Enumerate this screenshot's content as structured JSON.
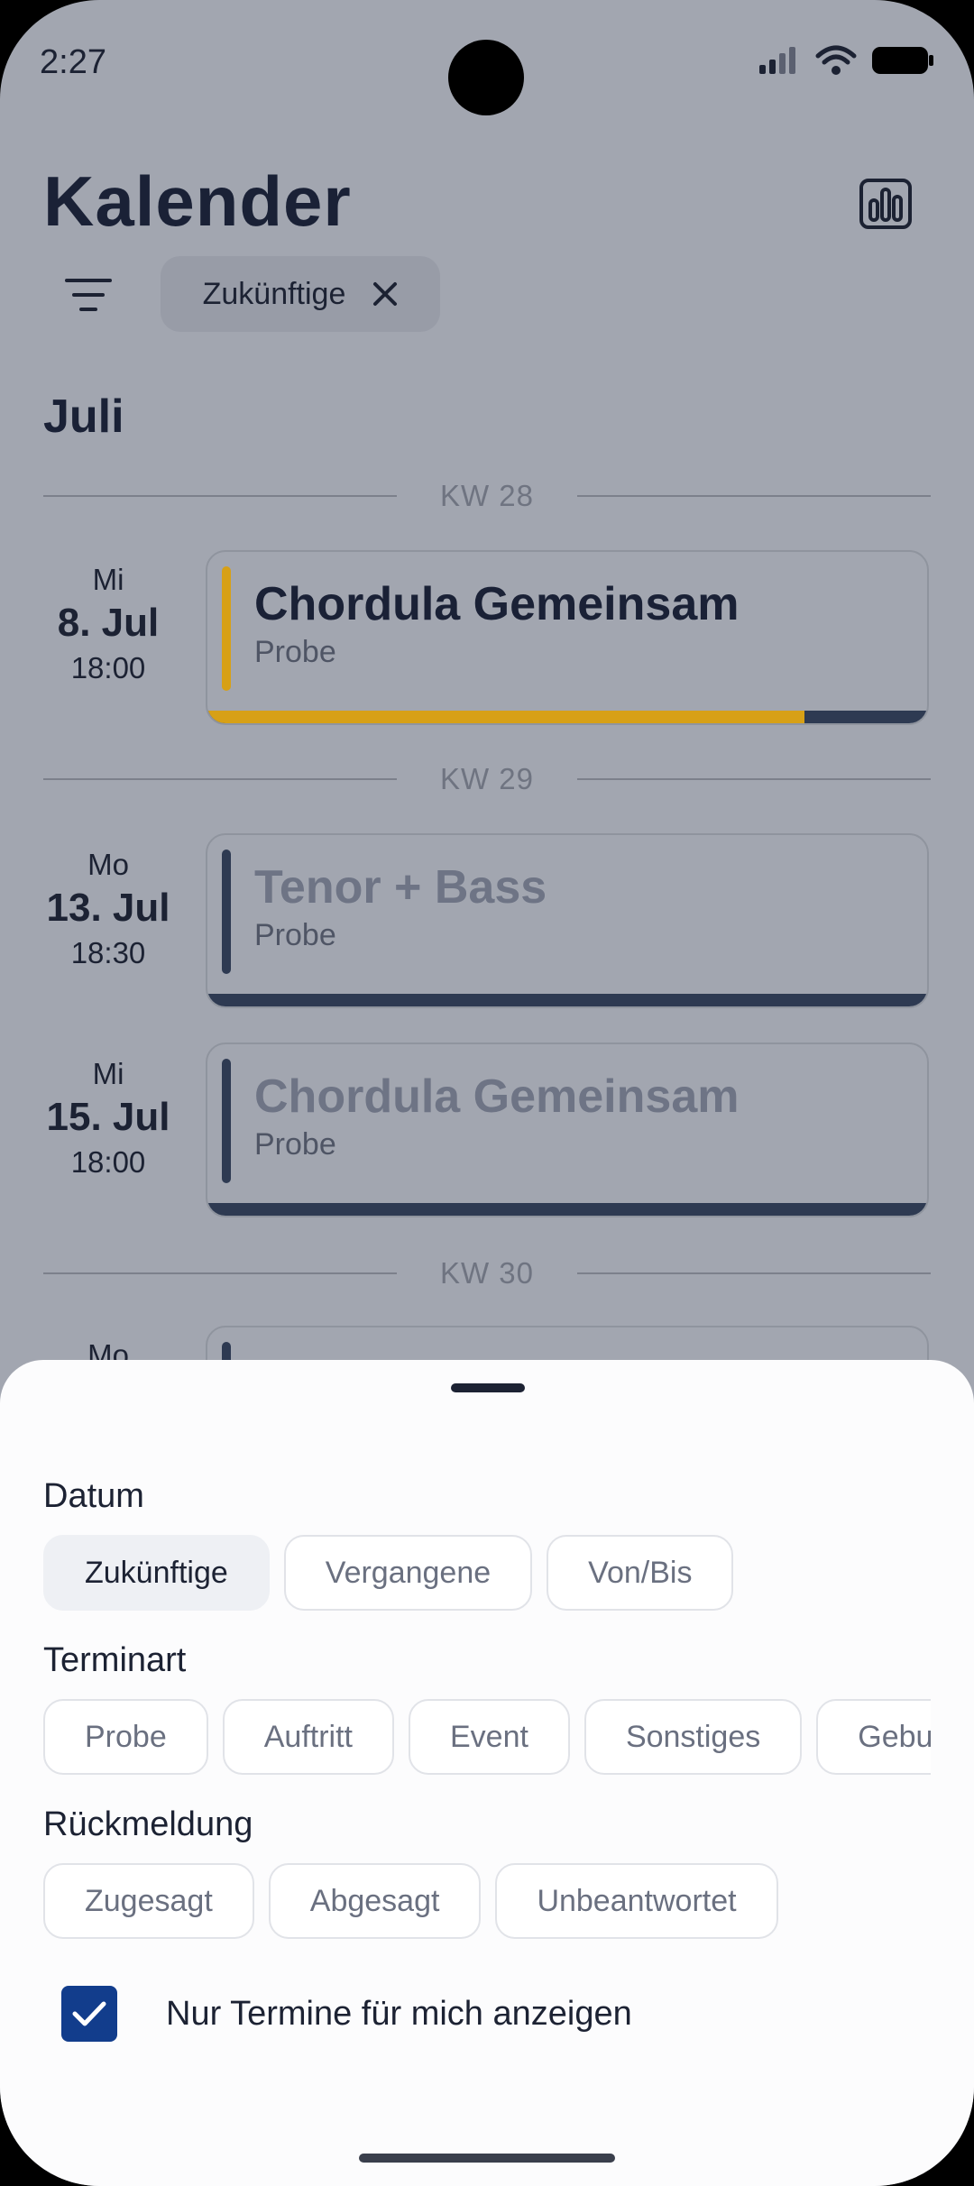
{
  "status": {
    "time": "2:27"
  },
  "header": {
    "title": "Kalender",
    "active_filter": "Zukünftige"
  },
  "month": "Juli",
  "weeks": [
    "KW 28",
    "KW 29",
    "KW 30"
  ],
  "events": [
    {
      "dow": "Mi",
      "day": "8. Jul",
      "time": "18:00",
      "title": "Chordula Gemeinsam",
      "type": "Probe",
      "accent": "#d7a016",
      "progress": 0.83
    },
    {
      "dow": "Mo",
      "day": "13. Jul",
      "time": "18:30",
      "title": "Tenor + Bass",
      "type": "Probe",
      "accent": "#2e3a52",
      "progress": 0
    },
    {
      "dow": "Mi",
      "day": "15. Jul",
      "time": "18:00",
      "title": "Chordula Gemeinsam",
      "type": "Probe",
      "accent": "#2e3a52",
      "progress": 0
    }
  ],
  "next_event_dow": "Mo",
  "sheet": {
    "date_label": "Datum",
    "date_options": [
      "Zukünftige",
      "Vergangene",
      "Von/Bis"
    ],
    "type_label": "Terminart",
    "type_options": [
      "Probe",
      "Auftritt",
      "Event",
      "Sonstiges",
      "Geburtstag"
    ],
    "response_label": "Rückmeldung",
    "response_options": [
      "Zugesagt",
      "Abgesagt",
      "Unbeantwortet"
    ],
    "only_mine_label": "Nur Termine für mich anzeigen",
    "only_mine_checked": true
  },
  "colors": {
    "accent_yellow": "#d7a016",
    "primary": "#123d8c",
    "dark": "#2e3a52"
  }
}
